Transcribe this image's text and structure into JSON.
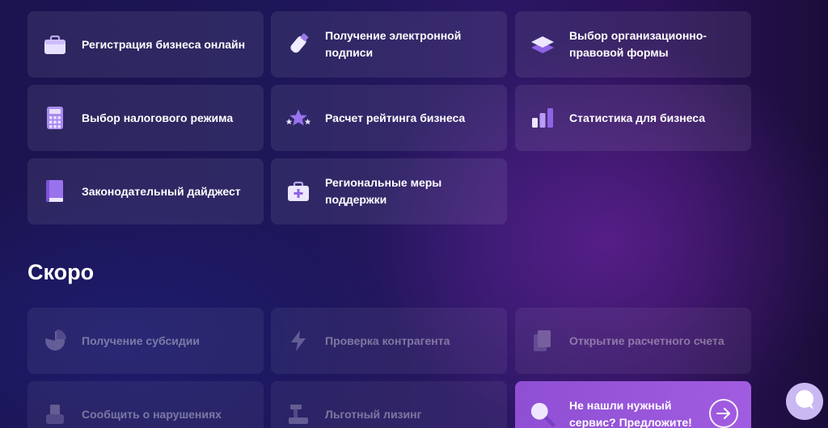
{
  "services": [
    {
      "label": "Регистрация бизнеса онлайн",
      "icon": "briefcase-icon"
    },
    {
      "label": "Получение электронной подписи",
      "icon": "usb-key-icon"
    },
    {
      "label": "Выбор организационно-правовой формы",
      "icon": "layers-icon"
    },
    {
      "label": "Выбор налогового режима",
      "icon": "calculator-icon"
    },
    {
      "label": "Расчет рейтинга бизнеса",
      "icon": "stars-icon"
    },
    {
      "label": "Статистика для бизнеса",
      "icon": "bar-chart-icon"
    },
    {
      "label": "Законодательный дайджест",
      "icon": "book-icon"
    },
    {
      "label": "Региональные меры поддержки",
      "icon": "first-aid-kit-icon"
    }
  ],
  "soon": {
    "title": "Скоро",
    "items": [
      {
        "label": "Получение субсидии",
        "icon": "pie-chart-icon"
      },
      {
        "label": "Проверка контрагента",
        "icon": "lightning-icon"
      },
      {
        "label": "Открытие расчетного счета",
        "icon": "documents-icon"
      },
      {
        "label": "Сообщить о нарушениях",
        "icon": "megaphone-icon"
      },
      {
        "label": "Льготный лизинг",
        "icon": "machine-icon"
      }
    ]
  },
  "suggest": {
    "label": "Не нашли нужный сервис? Предложите!",
    "icon": "magnifier-icon"
  },
  "chat": {
    "icon": "chat-bubble-icon"
  }
}
